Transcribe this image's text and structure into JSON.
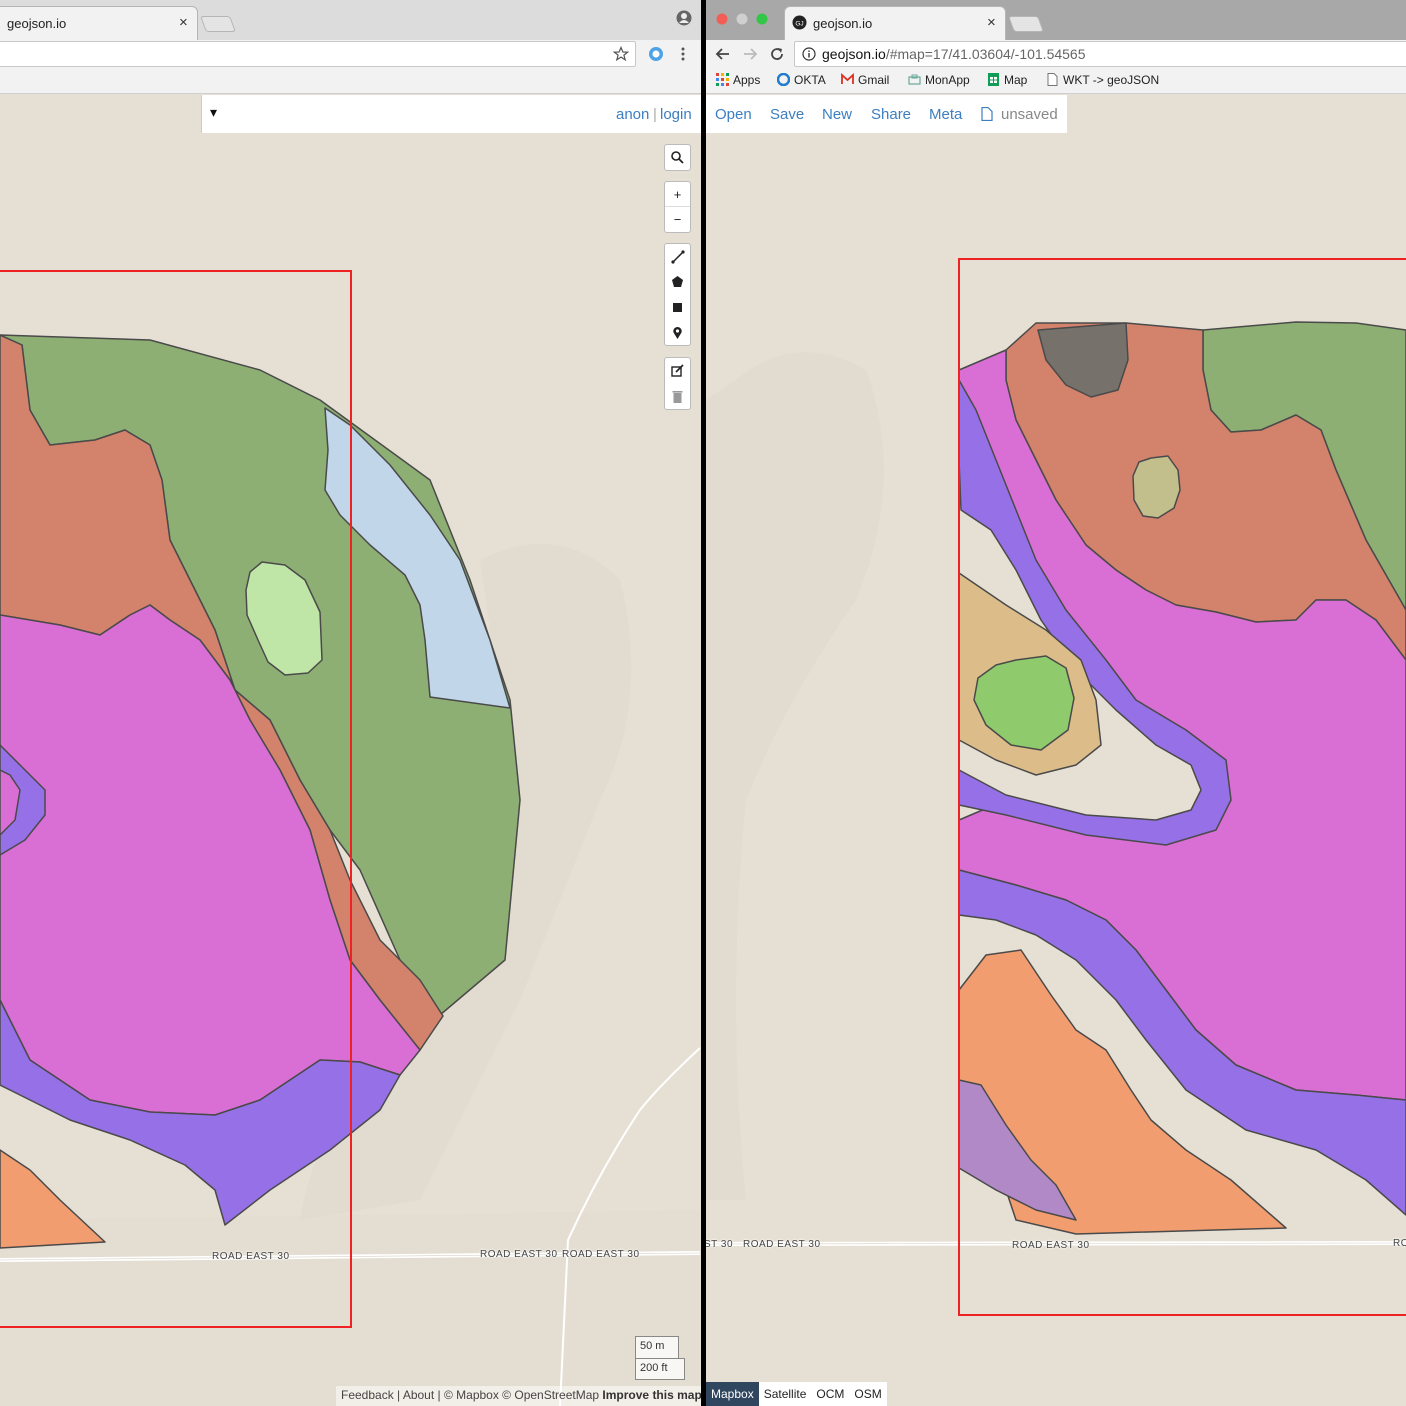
{
  "left": {
    "tab_title": "geojson.io",
    "tab_close": "×",
    "dropdown_caret": "▾",
    "auth": {
      "anon": "anon",
      "separator": "|",
      "login": "login"
    },
    "controls": {
      "search": "⚲",
      "zoom_in": "+",
      "zoom_out": "−"
    },
    "road_labels": [
      "ROAD EAST 30",
      "ROAD EAST 30",
      "ROAD EAST 30"
    ],
    "scale": {
      "metric": "50 m",
      "imperial": "200 ft"
    },
    "attribution": {
      "feedback": "Feedback",
      "about": "About",
      "copyright": "© Mapbox © OpenStreetMap",
      "improve": "Improve this map"
    }
  },
  "right": {
    "tab_title": "geojson.io",
    "tab_close": "×",
    "url_host": "geojson.io",
    "url_path": "/#map=17/41.03604/-101.54565",
    "bookmarks": [
      "Apps",
      "OKTA",
      "Gmail",
      "MonApp",
      "Map",
      "WKT -> geoJSON"
    ],
    "toolbar": {
      "open": "Open",
      "save": "Save",
      "new": "New",
      "share": "Share",
      "meta": "Meta",
      "status": "unsaved"
    },
    "road_labels": [
      "ST 30",
      "ROAD EAST 30",
      "ROAD EAST 30",
      "RO"
    ],
    "layers": [
      "Mapbox",
      "Satellite",
      "OCM",
      "OSM"
    ],
    "active_layer": "Mapbox"
  },
  "colors": {
    "map_background": "#e6e0d4",
    "selection_box": "#ee2222",
    "magenta": "#d96fd4",
    "purple": "#9670e6",
    "terracotta": "#d3826c",
    "sage_green": "#8eaf74",
    "light_green": "#bfe6a6",
    "light_blue": "#c1d6e8",
    "orange": "#f29d6f",
    "tan": "#dcbd8a",
    "bright_green": "#8fcb6c",
    "olive": "#c2bf8c",
    "dark_gray": "#76716b",
    "lavender": "#b089c6",
    "link_blue": "#3c7fc1"
  }
}
